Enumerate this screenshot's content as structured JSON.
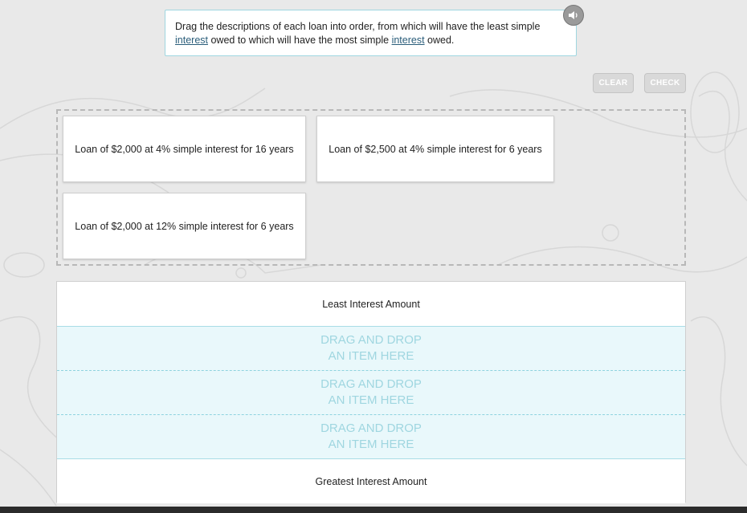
{
  "prompt": {
    "part1": "Drag the descriptions of each loan into order, from which will have the least simple ",
    "term1": "interest",
    "part2": " owed to which will have the most simple ",
    "term2": "interest",
    "part3": " owed."
  },
  "toolbar": {
    "clear_label": "CLEAR",
    "check_label": "CHECK"
  },
  "cards": [
    "Loan of $2,000 at 4% simple interest for 16 years",
    "Loan of $2,500 at 4% simple interest for 6 years",
    "Loan of $2,000 at 12% simple interest for 6 years"
  ],
  "order": {
    "top_label": "Least Interest Amount",
    "bottom_label": "Greatest Interest Amount",
    "slot_text": "DRAG AND DROP\nAN ITEM HERE"
  },
  "colors": {
    "accent": "#9fd6e0",
    "slot_bg": "#e9f8fb",
    "button_disabled": "#d9d9d9"
  }
}
